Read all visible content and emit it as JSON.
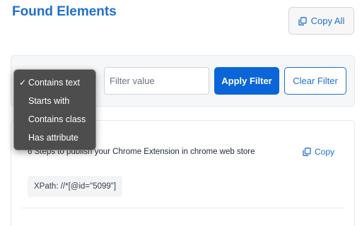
{
  "header": {
    "title": "Found Elements",
    "copy_all_label": "Copy All"
  },
  "filter": {
    "options": [
      {
        "label": "Contains text",
        "selected": true
      },
      {
        "label": "Starts with",
        "selected": false
      },
      {
        "label": "Contains class",
        "selected": false
      },
      {
        "label": "Has attribute",
        "selected": false
      }
    ],
    "check_mark": "✓",
    "input_placeholder": "Filter value",
    "input_value": "",
    "apply_label": "Apply Filter",
    "clear_label": "Clear Filter"
  },
  "results": [
    {
      "text": "6 Steps to publish your Chrome Extension in chrome web store",
      "copy_label": "Copy",
      "xpath": "XPath: //*[@id=\"5099\"]"
    }
  ],
  "colors": {
    "accent": "#1f6fd1",
    "primary_button": "#0a66d8"
  },
  "icons": {
    "copy": "copy-icon"
  }
}
